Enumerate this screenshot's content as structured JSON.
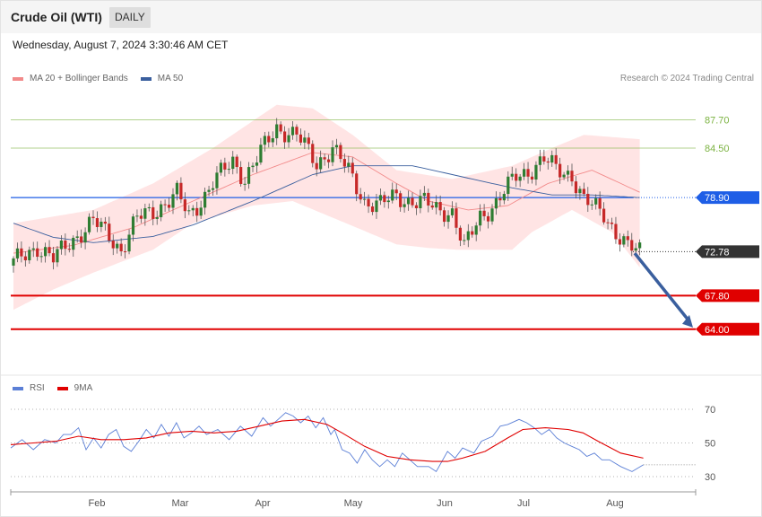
{
  "header": {
    "title": "Crude Oil (WTI)",
    "timeframe": "DAILY"
  },
  "timestamp": "Wednesday, August 7, 2024 3:30:46 AM CET",
  "legend": {
    "ma20_label": "MA 20 + Bollinger Bands",
    "ma50_label": "MA 50",
    "ma20_color": "#f28a8a",
    "ma50_color": "#3a5f9e",
    "copyright": "Research © 2024 Trading Central"
  },
  "rsi_legend": {
    "rsi_label": "RSI",
    "ma_label": "9MA",
    "rsi_color": "#5b7fd6",
    "ma_color": "#e00000"
  },
  "colors": {
    "bullish": "#2e7d32",
    "bearish": "#c62828",
    "resistance": "#7cb342",
    "pivot": "#1e5ee6",
    "support": "#e00000",
    "current": "#333333",
    "band_fill": "#ffe3e3"
  },
  "chart_data": [
    {
      "type": "candlestick",
      "title": "Crude Oil (WTI)",
      "timeframe": "DAILY",
      "ylim": [
        59.0,
        91.0
      ],
      "x_ticks": [
        "Feb",
        "Mar",
        "Apr",
        "May",
        "Jun",
        "Jul",
        "Aug"
      ],
      "levels": [
        {
          "label": "87.70",
          "value": 87.7,
          "kind": "resistance"
        },
        {
          "label": "84.50",
          "value": 84.5,
          "kind": "resistance"
        },
        {
          "label": "78.90",
          "value": 78.9,
          "kind": "pivot"
        },
        {
          "label": "72.78",
          "value": 72.78,
          "kind": "current"
        },
        {
          "label": "67.80",
          "value": 67.8,
          "kind": "support"
        },
        {
          "label": "64.00",
          "value": 64.0,
          "kind": "support"
        }
      ],
      "forecast_arrow": {
        "from": 72.6,
        "to": 64.2
      },
      "waypoints_close": [
        [
          0,
          71.5
        ],
        [
          6,
          73.4
        ],
        [
          10,
          71.9
        ],
        [
          14,
          73.8
        ],
        [
          20,
          76.2
        ],
        [
          24,
          74.6
        ],
        [
          27,
          73.0
        ],
        [
          31,
          76.5
        ],
        [
          36,
          77.6
        ],
        [
          41,
          79.3
        ],
        [
          44,
          76.8
        ],
        [
          48,
          79.2
        ],
        [
          50,
          80.6
        ],
        [
          55,
          83.0
        ],
        [
          58,
          81.1
        ],
        [
          62,
          84.0
        ],
        [
          66,
          86.8
        ],
        [
          71,
          86.0
        ],
        [
          76,
          82.7
        ],
        [
          80,
          84.6
        ],
        [
          84,
          81.8
        ],
        [
          88,
          78.5
        ],
        [
          92,
          78.1
        ],
        [
          96,
          79.1
        ],
        [
          99,
          78.6
        ],
        [
          103,
          78.3
        ],
        [
          106,
          77.6
        ],
        [
          110,
          77.3
        ],
        [
          113,
          73.1
        ],
        [
          117,
          76.8
        ],
        [
          121,
          78.3
        ],
        [
          126,
          81.3
        ],
        [
          129,
          81.9
        ],
        [
          133,
          83.2
        ],
        [
          136,
          82.1
        ],
        [
          140,
          81.5
        ],
        [
          143,
          78.5
        ],
        [
          148,
          77.1
        ],
        [
          151,
          75.0
        ],
        [
          154,
          73.2
        ],
        [
          157,
          72.8
        ]
      ],
      "bollinger_upper": [
        [
          0,
          76.0
        ],
        [
          20,
          77.5
        ],
        [
          35,
          80.5
        ],
        [
          50,
          84.5
        ],
        [
          66,
          89.4
        ],
        [
          75,
          89.0
        ],
        [
          85,
          86.0
        ],
        [
          96,
          82.0
        ],
        [
          110,
          81.0
        ],
        [
          125,
          82.5
        ],
        [
          135,
          84.5
        ],
        [
          143,
          86.0
        ],
        [
          157,
          85.5
        ]
      ],
      "bollinger_lower": [
        [
          0,
          66.2
        ],
        [
          10,
          68.5
        ],
        [
          20,
          70.4
        ],
        [
          35,
          73.0
        ],
        [
          45,
          76.0
        ],
        [
          60,
          78.0
        ],
        [
          70,
          78.5
        ],
        [
          86,
          75.5
        ],
        [
          96,
          73.6
        ],
        [
          104,
          73.2
        ],
        [
          111,
          73.0
        ],
        [
          125,
          73.0
        ],
        [
          130,
          75.0
        ],
        [
          140,
          77.5
        ],
        [
          150,
          75.0
        ],
        [
          157,
          71.0
        ]
      ],
      "ma20": [
        [
          0,
          72.6
        ],
        [
          15,
          73.5
        ],
        [
          30,
          75.5
        ],
        [
          45,
          78.5
        ],
        [
          60,
          81.5
        ],
        [
          75,
          84.0
        ],
        [
          85,
          83.5
        ],
        [
          96,
          80.5
        ],
        [
          104,
          78.5
        ],
        [
          114,
          77.5
        ],
        [
          124,
          78.0
        ],
        [
          134,
          80.5
        ],
        [
          145,
          82.0
        ],
        [
          157,
          79.5
        ]
      ],
      "ma50": [
        [
          0,
          76.0
        ],
        [
          10,
          74.4
        ],
        [
          20,
          73.8
        ],
        [
          35,
          74.5
        ],
        [
          45,
          75.8
        ],
        [
          60,
          78.5
        ],
        [
          75,
          81.5
        ],
        [
          85,
          82.5
        ],
        [
          100,
          82.5
        ],
        [
          110,
          81.5
        ],
        [
          125,
          80.0
        ],
        [
          135,
          79.2
        ],
        [
          145,
          79.2
        ],
        [
          157,
          78.9
        ]
      ]
    },
    {
      "type": "line",
      "name": "RSI panel",
      "ylim": [
        22,
        78
      ],
      "y_ticks": [
        70,
        50,
        30
      ],
      "series": [
        {
          "name": "RSI",
          "color": "#5b7fd6",
          "points": [
            [
              0,
              47
            ],
            [
              3,
              52
            ],
            [
              6,
              46
            ],
            [
              9,
              52
            ],
            [
              12,
              50
            ],
            [
              14,
              55
            ],
            [
              16,
              55
            ],
            [
              18,
              59
            ],
            [
              20,
              46
            ],
            [
              22,
              53
            ],
            [
              24,
              47
            ],
            [
              26,
              55
            ],
            [
              28,
              58
            ],
            [
              30,
              48
            ],
            [
              32,
              45
            ],
            [
              34,
              51
            ],
            [
              36,
              58
            ],
            [
              38,
              53
            ],
            [
              40,
              61
            ],
            [
              42,
              54
            ],
            [
              44,
              62
            ],
            [
              46,
              53
            ],
            [
              48,
              56
            ],
            [
              50,
              60
            ],
            [
              52,
              55
            ],
            [
              55,
              58
            ],
            [
              58,
              52
            ],
            [
              61,
              60
            ],
            [
              64,
              54
            ],
            [
              67,
              65
            ],
            [
              69,
              60
            ],
            [
              71,
              64
            ],
            [
              73,
              68
            ],
            [
              75,
              66
            ],
            [
              77,
              62
            ],
            [
              79,
              66
            ],
            [
              81,
              59
            ],
            [
              83,
              65
            ],
            [
              85,
              55
            ],
            [
              86,
              58
            ],
            [
              88,
              46
            ],
            [
              90,
              44
            ],
            [
              92,
              38
            ],
            [
              94,
              46
            ],
            [
              96,
              40
            ],
            [
              98,
              36
            ],
            [
              100,
              40
            ],
            [
              102,
              36
            ],
            [
              104,
              44
            ],
            [
              106,
              40
            ],
            [
              108,
              36
            ],
            [
              111,
              36
            ],
            [
              113,
              33
            ],
            [
              116,
              45
            ],
            [
              118,
              41
            ],
            [
              120,
              47
            ],
            [
              123,
              44
            ],
            [
              125,
              51
            ],
            [
              128,
              54
            ],
            [
              130,
              60
            ],
            [
              132,
              61
            ],
            [
              135,
              64
            ],
            [
              137,
              62
            ],
            [
              139,
              59
            ],
            [
              141,
              55
            ],
            [
              143,
              58
            ],
            [
              145,
              53
            ],
            [
              147,
              50
            ],
            [
              149,
              48
            ],
            [
              151,
              46
            ],
            [
              153,
              42
            ],
            [
              155,
              44
            ],
            [
              157,
              40
            ],
            [
              159,
              40
            ],
            [
              162,
              36
            ],
            [
              165,
              33
            ],
            [
              168,
              37
            ]
          ]
        },
        {
          "name": "9MA",
          "color": "#e00000",
          "points": [
            [
              0,
              49
            ],
            [
              6,
              50
            ],
            [
              12,
              51
            ],
            [
              18,
              54
            ],
            [
              24,
              52
            ],
            [
              30,
              52
            ],
            [
              36,
              53
            ],
            [
              42,
              56
            ],
            [
              48,
              57
            ],
            [
              54,
              56
            ],
            [
              60,
              57
            ],
            [
              66,
              60
            ],
            [
              72,
              63
            ],
            [
              78,
              64
            ],
            [
              84,
              61
            ],
            [
              88,
              56
            ],
            [
              94,
              48
            ],
            [
              100,
              42
            ],
            [
              106,
              40
            ],
            [
              112,
              39
            ],
            [
              116,
              39
            ],
            [
              120,
              41
            ],
            [
              126,
              45
            ],
            [
              132,
              53
            ],
            [
              136,
              58
            ],
            [
              142,
              59
            ],
            [
              148,
              58
            ],
            [
              152,
              56
            ],
            [
              156,
              51
            ],
            [
              162,
              44
            ],
            [
              168,
              41
            ]
          ]
        }
      ]
    }
  ]
}
